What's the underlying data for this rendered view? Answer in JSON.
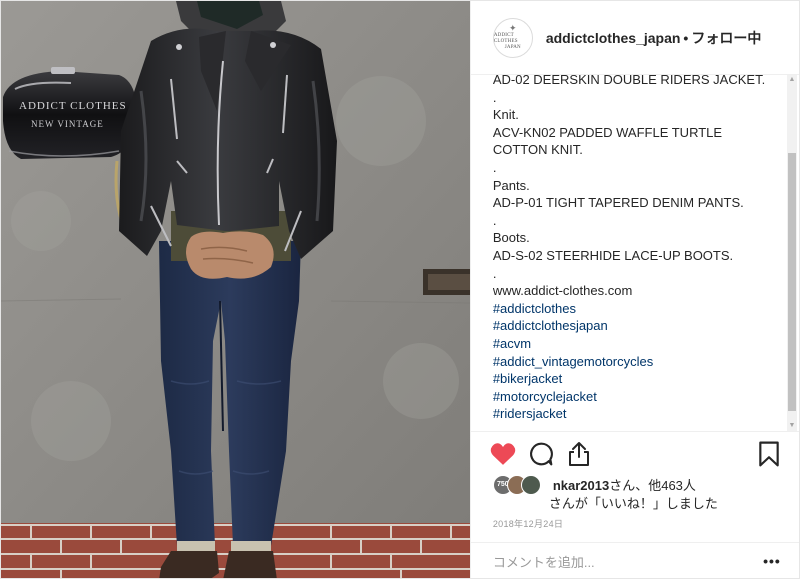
{
  "post": {
    "username": "addictclothes_japan",
    "separator": "•",
    "follow_label": "フォロー中",
    "avatar_text": {
      "mark": "✦",
      "line1": "ADDICT CLOTHES",
      "line2": "JAPAN"
    }
  },
  "photo": {
    "tank_lettering": "ADDICT CLOTHES",
    "tank_sub": "NEW VINTAGE"
  },
  "caption": {
    "lines": [
      "AD-02 DEERSKIN DOUBLE RIDERS JACKET.",
      ".",
      "Knit.",
      "ACV-KN02 PADDED WAFFLE TURTLE",
      "COTTON KNIT.",
      ".",
      "Pants.",
      "AD-P-01 TIGHT TAPERED DENIM PANTS.",
      ".",
      "Boots.",
      "AD-S-02 STEERHIDE LACE-UP BOOTS.",
      ".",
      "www.addict-clothes.com"
    ],
    "hashtags": [
      "#addictclothes",
      "#addictclothesjapan",
      "#acvm",
      "#addict_vintagemotorcycles",
      "#bikerjacket",
      "#motorcyclejacket",
      "#ridersjacket"
    ]
  },
  "actions": {
    "liked": true,
    "like_color": "#ed4956"
  },
  "likes": {
    "first_liker": "nkar2013",
    "line1_suffix": "さん、他463人",
    "line2": "さんが「いいね！」しました",
    "mini_avatar_label": "750"
  },
  "date": "2018年12月24日",
  "comment": {
    "placeholder": "コメントを追加...",
    "more_label": "•••"
  }
}
